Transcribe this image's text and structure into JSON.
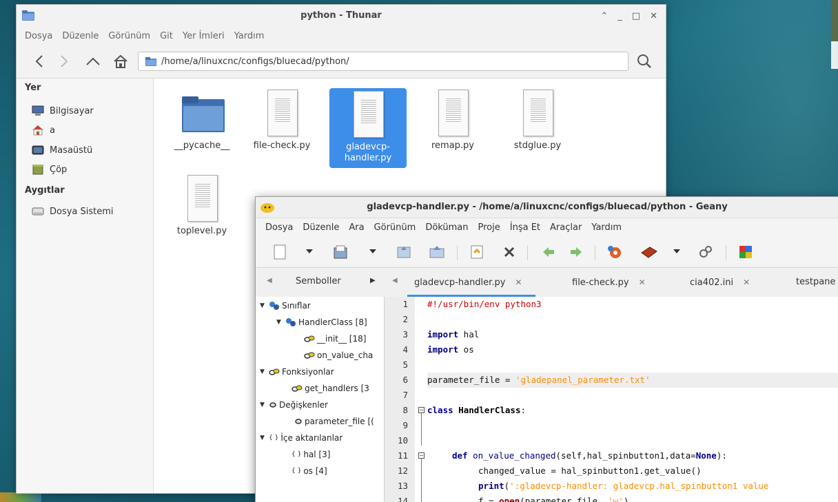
{
  "thunar": {
    "title": "python - Thunar",
    "menu": [
      "Dosya",
      "Düzenle",
      "Görünüm",
      "Git",
      "Yer İmleri",
      "Yardım"
    ],
    "path": "/home/a/linuxcnc/configs/bluecad/python/",
    "sidebar": {
      "places_header": "Yer",
      "places": [
        {
          "label": "Bilgisayar",
          "icon": "computer-icon"
        },
        {
          "label": "a",
          "icon": "home-icon"
        },
        {
          "label": "Masaüstü",
          "icon": "desktop-icon"
        },
        {
          "label": "Çöp",
          "icon": "trash-icon"
        }
      ],
      "devices_header": "Aygıtlar",
      "devices": [
        {
          "label": "Dosya Sistemi",
          "icon": "drive-icon"
        }
      ]
    },
    "files": [
      {
        "name": "__pycache__",
        "type": "folder"
      },
      {
        "name": "file-check.py",
        "type": "file"
      },
      {
        "name": "gladevcp-handler.py",
        "type": "file",
        "selected": true
      },
      {
        "name": "remap.py",
        "type": "file"
      },
      {
        "name": "stdglue.py",
        "type": "file"
      },
      {
        "name": "toplevel.py",
        "type": "file"
      }
    ]
  },
  "geany": {
    "title": "gladevcp-handler.py - /home/a/linuxcnc/configs/bluecad/python - Geany",
    "menu": [
      "Dosya",
      "Düzenle",
      "Ara",
      "Görünüm",
      "Döküman",
      "Proje",
      "İnşa Et",
      "Araçlar",
      "Yardım"
    ],
    "sidebar_tab": "Semboller",
    "tabs": [
      {
        "label": "gladevcp-handler.py",
        "active": true
      },
      {
        "label": "file-check.py"
      },
      {
        "label": "cia402.ini"
      },
      {
        "label": "testpane"
      }
    ],
    "symbols": {
      "classes": "Sınıflar",
      "handler_class": "HandlerClass [8]",
      "init": "__init__ [18]",
      "on_value": "on_value_cha",
      "functions": "Fonksiyonlar",
      "get_handlers": "get_handlers [3",
      "variables": "Değişkenler",
      "parameter_file": "parameter_file [(",
      "imports": "İçe aktarılanlar",
      "hal": "hal [3]",
      "os": "os [4]"
    },
    "line_numbers": [
      "1",
      "2",
      "3",
      "4",
      "5",
      "6",
      "7",
      "8",
      "9",
      "10",
      "11",
      "12",
      "13",
      "14"
    ],
    "code": {
      "l1": "#!/usr/bin/env python3",
      "l3_kw": "import",
      "l3_rest": " hal",
      "l4_kw": "import",
      "l4_rest": " os",
      "l6_a": "parameter_file = ",
      "l6_str": "'gladepanel_parameter.txt'",
      "l8_kw": "class",
      "l8_name": " HandlerClass",
      "l8_rest": ":",
      "l11_kw": "def",
      "l11_fn": " on_value_changed",
      "l11_args": "(self,hal_spinbutton1,data=",
      "l11_none": "None",
      "l11_end": "):",
      "l12": "changed_value = hal_spinbutton1.get_value()",
      "l13_kw": "print",
      "l13_open": "(",
      "l13_str": "':gladevcp-handler: gladevcp.hal_spinbutton1 value",
      "l14_a": "f = ",
      "l14_kw": "open",
      "l14_b": "(parameter_file, ",
      "l14_str": "'w'",
      "l14_c": ")"
    }
  }
}
